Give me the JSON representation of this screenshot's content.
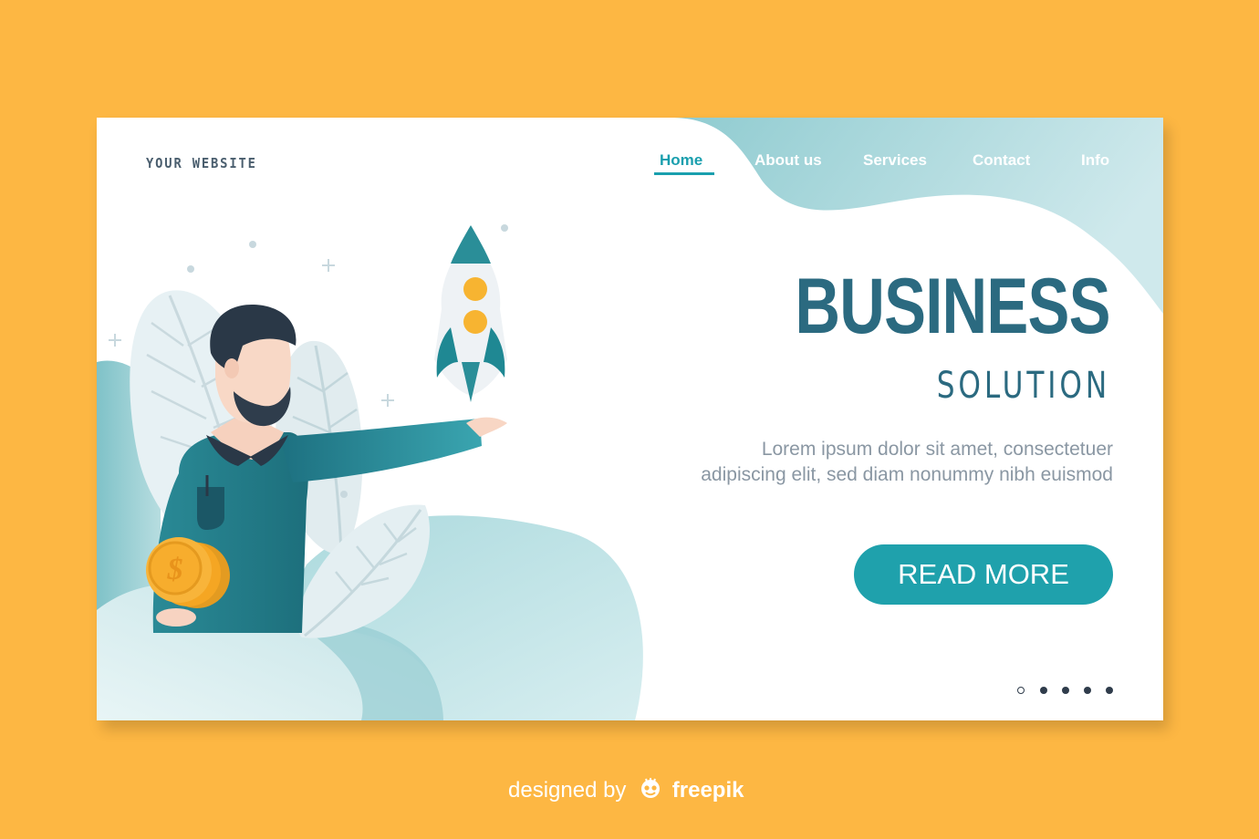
{
  "site": {
    "brand": "YOUR WEBSITE"
  },
  "nav": {
    "items": [
      {
        "label": "Home",
        "active": true
      },
      {
        "label": "About us",
        "active": false
      },
      {
        "label": "Services",
        "active": false
      },
      {
        "label": "Contact",
        "active": false
      },
      {
        "label": "Info",
        "active": false
      }
    ]
  },
  "hero": {
    "title": "BUSINESS",
    "subtitle": "SOLUTION",
    "description": "Lorem ipsum dolor sit amet, consectetuer adipiscing elit, sed diam nonummy nibh euismod",
    "cta_label": "READ MORE"
  },
  "carousel": {
    "slide_count": 5,
    "active_index": 0
  },
  "credit": {
    "prefix": "designed by",
    "brand": "freepik"
  },
  "colors": {
    "page_background": "#fdb743",
    "card_background": "#ffffff",
    "accent": "#1fa1ac",
    "title": "#2b6a80",
    "body_text": "#8a97a3",
    "dot": "#2f3c4b",
    "wave": "#9fd3d8",
    "coin": "#f5a623"
  },
  "icons": {
    "illustration": "businessman-holding-rocket-illustration",
    "rocket": "rocket-icon",
    "coins": "dollar-coins-icon",
    "credit_logo": "freepik-logo-icon"
  }
}
